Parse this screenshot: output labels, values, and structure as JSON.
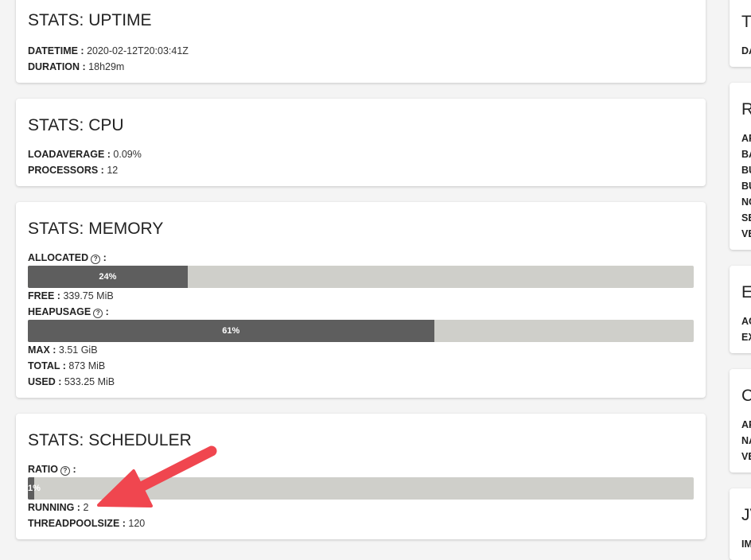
{
  "uptime": {
    "title": "STATS: UPTIME",
    "datetime_label": "DATETIME :",
    "datetime_value": "2020-02-12T20:03:41Z",
    "duration_label": "DURATION :",
    "duration_value": "18h29m"
  },
  "cpu": {
    "title": "STATS: CPU",
    "loadaverage_label": "LOADAVERAGE :",
    "loadaverage_value": "0.09%",
    "processors_label": "PROCESSORS :",
    "processors_value": "12"
  },
  "memory": {
    "title": "STATS: MEMORY",
    "allocated_label": "ALLOCATED",
    "allocated_percent": 24,
    "allocated_text": "24%",
    "free_label": "FREE :",
    "free_value": "339.75 MiB",
    "heapusage_label": "HEAPUSAGE",
    "heapusage_percent": 61,
    "heapusage_text": "61%",
    "max_label": "MAX :",
    "max_value": "3.51 GiB",
    "total_label": "TOTAL :",
    "total_value": "873 MiB",
    "used_label": "USED :",
    "used_value": "533.25 MiB"
  },
  "scheduler": {
    "title": "STATS: SCHEDULER",
    "ratio_label": "RATIO",
    "ratio_percent": 1,
    "ratio_text": "1%",
    "running_label": "RUNNING :",
    "running_value": "2",
    "threadpoolsize_label": "THREADPOOLSIZE :",
    "threadpoolsize_value": "120"
  },
  "right_cards": [
    {
      "title": "T",
      "rows": [
        "DA"
      ]
    },
    {
      "title": "R",
      "rows": [
        "AP",
        "BA",
        "BU",
        "BU",
        "NC",
        "SE",
        "VE"
      ]
    },
    {
      "title": "E",
      "rows": [
        "AC",
        "EX"
      ]
    },
    {
      "title": "C",
      "rows": [
        "AP",
        "NA",
        "VE"
      ]
    },
    {
      "title": "JV",
      "rows": [
        "IM"
      ]
    }
  ],
  "colors": {
    "bar_fill": "#5e5e5e",
    "bar_track": "#cfcfca",
    "annotation_arrow": "#f0464f"
  },
  "help_icon": "?"
}
